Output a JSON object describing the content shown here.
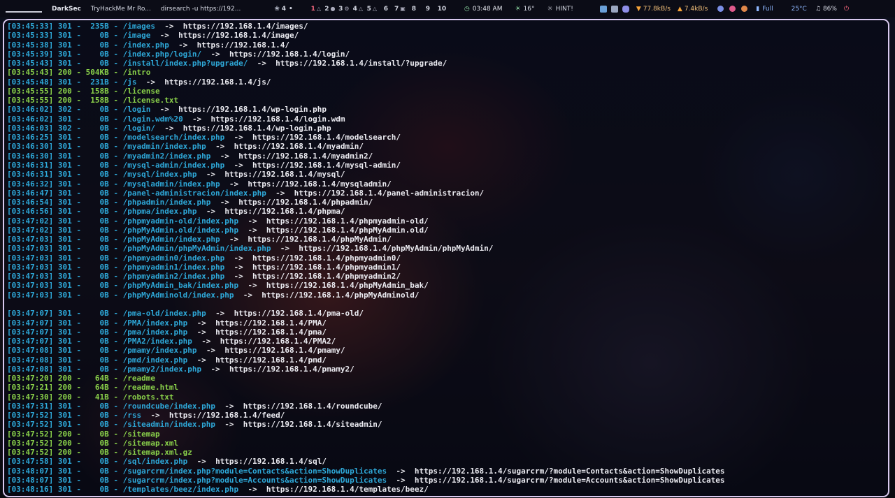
{
  "topbar": {
    "title": "DarkSec",
    "tabs": [
      "TryHackMe Mr Ro...",
      "dirsearch -u https://192..."
    ],
    "workspace_indicator": "4",
    "workspaces": [
      "1",
      "2",
      "3",
      "4",
      "5",
      "6",
      "7",
      "8",
      "9",
      "10"
    ],
    "clock": "03:48 AM",
    "temperature": "16°",
    "hint": "HINT!",
    "net_down": "77.8kB/s",
    "net_up": "7.4kB/s",
    "battery": "Full",
    "cpu_temp": "25°C",
    "volume": "86%",
    "colors": {
      "bar_bg": "#0b0c16",
      "active_workspace": "#ff6b81",
      "accent_green": "#8cd6a1",
      "net_orange": "#f6a43a"
    }
  },
  "terminal": {
    "border_color": "#d8c9ee",
    "colors": {
      "redirect": "#2ea8d8",
      "success": "#8ad14a",
      "target": "#ececf2"
    },
    "lines": [
      {
        "ts": "[03:45:33]",
        "code": "301",
        "size": "235B",
        "path": "/images",
        "target": "https://192.168.1.4/images/"
      },
      {
        "ts": "[03:45:33]",
        "code": "301",
        "size": "0B",
        "path": "/image",
        "target": "https://192.168.1.4/image/"
      },
      {
        "ts": "[03:45:38]",
        "code": "301",
        "size": "0B",
        "path": "/index.php",
        "target": "https://192.168.1.4/"
      },
      {
        "ts": "[03:45:39]",
        "code": "301",
        "size": "0B",
        "path": "/index.php/login/",
        "target": "https://192.168.1.4/login/"
      },
      {
        "ts": "[03:45:43]",
        "code": "301",
        "size": "0B",
        "path": "/install/index.php?upgrade/",
        "target": "https://192.168.1.4/install/?upgrade/"
      },
      {
        "ts": "[03:45:43]",
        "code": "200",
        "size": "504KB",
        "path": "/intro",
        "target": ""
      },
      {
        "ts": "[03:45:48]",
        "code": "301",
        "size": "231B",
        "path": "/js",
        "target": "https://192.168.1.4/js/"
      },
      {
        "ts": "[03:45:55]",
        "code": "200",
        "size": "158B",
        "path": "/license",
        "target": ""
      },
      {
        "ts": "[03:45:55]",
        "code": "200",
        "size": "158B",
        "path": "/license.txt",
        "target": ""
      },
      {
        "ts": "[03:46:02]",
        "code": "302",
        "size": "0B",
        "path": "/login",
        "target": "https://192.168.1.4/wp-login.php"
      },
      {
        "ts": "[03:46:02]",
        "code": "301",
        "size": "0B",
        "path": "/login.wdm%20",
        "target": "https://192.168.1.4/login.wdm"
      },
      {
        "ts": "[03:46:03]",
        "code": "302",
        "size": "0B",
        "path": "/login/",
        "target": "https://192.168.1.4/wp-login.php"
      },
      {
        "ts": "[03:46:25]",
        "code": "301",
        "size": "0B",
        "path": "/modelsearch/index.php",
        "target": "https://192.168.1.4/modelsearch/"
      },
      {
        "ts": "[03:46:30]",
        "code": "301",
        "size": "0B",
        "path": "/myadmin/index.php",
        "target": "https://192.168.1.4/myadmin/"
      },
      {
        "ts": "[03:46:30]",
        "code": "301",
        "size": "0B",
        "path": "/myadmin2/index.php",
        "target": "https://192.168.1.4/myadmin2/"
      },
      {
        "ts": "[03:46:31]",
        "code": "301",
        "size": "0B",
        "path": "/mysql-admin/index.php",
        "target": "https://192.168.1.4/mysql-admin/"
      },
      {
        "ts": "[03:46:31]",
        "code": "301",
        "size": "0B",
        "path": "/mysql/index.php",
        "target": "https://192.168.1.4/mysql/"
      },
      {
        "ts": "[03:46:32]",
        "code": "301",
        "size": "0B",
        "path": "/mysqladmin/index.php",
        "target": "https://192.168.1.4/mysqladmin/"
      },
      {
        "ts": "[03:46:47]",
        "code": "301",
        "size": "0B",
        "path": "/panel-administracion/index.php",
        "target": "https://192.168.1.4/panel-administracion/"
      },
      {
        "ts": "[03:46:54]",
        "code": "301",
        "size": "0B",
        "path": "/phpadmin/index.php",
        "target": "https://192.168.1.4/phpadmin/"
      },
      {
        "ts": "[03:46:56]",
        "code": "301",
        "size": "0B",
        "path": "/phpma/index.php",
        "target": "https://192.168.1.4/phpma/"
      },
      {
        "ts": "[03:47:02]",
        "code": "301",
        "size": "0B",
        "path": "/phpmyadmin-old/index.php",
        "target": "https://192.168.1.4/phpmyadmin-old/"
      },
      {
        "ts": "[03:47:02]",
        "code": "301",
        "size": "0B",
        "path": "/phpMyAdmin.old/index.php",
        "target": "https://192.168.1.4/phpMyAdmin.old/"
      },
      {
        "ts": "[03:47:03]",
        "code": "301",
        "size": "0B",
        "path": "/phpMyAdmin/index.php",
        "target": "https://192.168.1.4/phpMyAdmin/"
      },
      {
        "ts": "[03:47:03]",
        "code": "301",
        "size": "0B",
        "path": "/phpMyAdmin/phpMyAdmin/index.php",
        "target": "https://192.168.1.4/phpMyAdmin/phpMyAdmin/"
      },
      {
        "ts": "[03:47:03]",
        "code": "301",
        "size": "0B",
        "path": "/phpmyadmin0/index.php",
        "target": "https://192.168.1.4/phpmyadmin0/"
      },
      {
        "ts": "[03:47:03]",
        "code": "301",
        "size": "0B",
        "path": "/phpmyadmin1/index.php",
        "target": "https://192.168.1.4/phpmyadmin1/"
      },
      {
        "ts": "[03:47:03]",
        "code": "301",
        "size": "0B",
        "path": "/phpmyadmin2/index.php",
        "target": "https://192.168.1.4/phpmyadmin2/"
      },
      {
        "ts": "[03:47:03]",
        "code": "301",
        "size": "0B",
        "path": "/phpMyAdmin_bak/index.php",
        "target": "https://192.168.1.4/phpMyAdmin_bak/"
      },
      {
        "ts": "[03:47:03]",
        "code": "301",
        "size": "0B",
        "path": "/phpMyAdminold/index.php",
        "target": "https://192.168.1.4/phpMyAdminold/"
      },
      {
        "blank": true
      },
      {
        "ts": "[03:47:07]",
        "code": "301",
        "size": "0B",
        "path": "/pma-old/index.php",
        "target": "https://192.168.1.4/pma-old/"
      },
      {
        "ts": "[03:47:07]",
        "code": "301",
        "size": "0B",
        "path": "/PMA/index.php",
        "target": "https://192.168.1.4/PMA/"
      },
      {
        "ts": "[03:47:07]",
        "code": "301",
        "size": "0B",
        "path": "/pma/index.php",
        "target": "https://192.168.1.4/pma/"
      },
      {
        "ts": "[03:47:07]",
        "code": "301",
        "size": "0B",
        "path": "/PMA2/index.php",
        "target": "https://192.168.1.4/PMA2/"
      },
      {
        "ts": "[03:47:08]",
        "code": "301",
        "size": "0B",
        "path": "/pmamy/index.php",
        "target": "https://192.168.1.4/pmamy/"
      },
      {
        "ts": "[03:47:08]",
        "code": "301",
        "size": "0B",
        "path": "/pmd/index.php",
        "target": "https://192.168.1.4/pmd/"
      },
      {
        "ts": "[03:47:08]",
        "code": "301",
        "size": "0B",
        "path": "/pmamy2/index.php",
        "target": "https://192.168.1.4/pmamy2/"
      },
      {
        "ts": "[03:47:20]",
        "code": "200",
        "size": "64B",
        "path": "/readme",
        "target": ""
      },
      {
        "ts": "[03:47:21]",
        "code": "200",
        "size": "64B",
        "path": "/readme.html",
        "target": ""
      },
      {
        "ts": "[03:47:30]",
        "code": "200",
        "size": "41B",
        "path": "/robots.txt",
        "target": ""
      },
      {
        "ts": "[03:47:31]",
        "code": "301",
        "size": "0B",
        "path": "/roundcube/index.php",
        "target": "https://192.168.1.4/roundcube/"
      },
      {
        "ts": "[03:47:52]",
        "code": "301",
        "size": "0B",
        "path": "/rss",
        "target": "https://192.168.1.4/feed/"
      },
      {
        "ts": "[03:47:52]",
        "code": "301",
        "size": "0B",
        "path": "/siteadmin/index.php",
        "target": "https://192.168.1.4/siteadmin/"
      },
      {
        "ts": "[03:47:52]",
        "code": "200",
        "size": "0B",
        "path": "/sitemap",
        "target": ""
      },
      {
        "ts": "[03:47:52]",
        "code": "200",
        "size": "0B",
        "path": "/sitemap.xml",
        "target": ""
      },
      {
        "ts": "[03:47:52]",
        "code": "200",
        "size": "0B",
        "path": "/sitemap.xml.gz",
        "target": ""
      },
      {
        "ts": "[03:47:58]",
        "code": "301",
        "size": "0B",
        "path": "/sql/index.php",
        "target": "https://192.168.1.4/sql/"
      },
      {
        "ts": "[03:48:07]",
        "code": "301",
        "size": "0B",
        "path": "/sugarcrm/index.php?module=Contacts&action=ShowDuplicates",
        "target": "https://192.168.1.4/sugarcrm/?module=Contacts&action=ShowDuplicates"
      },
      {
        "ts": "[03:48:07]",
        "code": "301",
        "size": "0B",
        "path": "/sugarcrm/index.php?module=Accounts&action=ShowDuplicates",
        "target": "https://192.168.1.4/sugarcrm/?module=Accounts&action=ShowDuplicates"
      },
      {
        "ts": "[03:48:16]",
        "code": "301",
        "size": "0B",
        "path": "/templates/beez/index.php",
        "target": "https://192.168.1.4/templates/beez/"
      }
    ]
  }
}
